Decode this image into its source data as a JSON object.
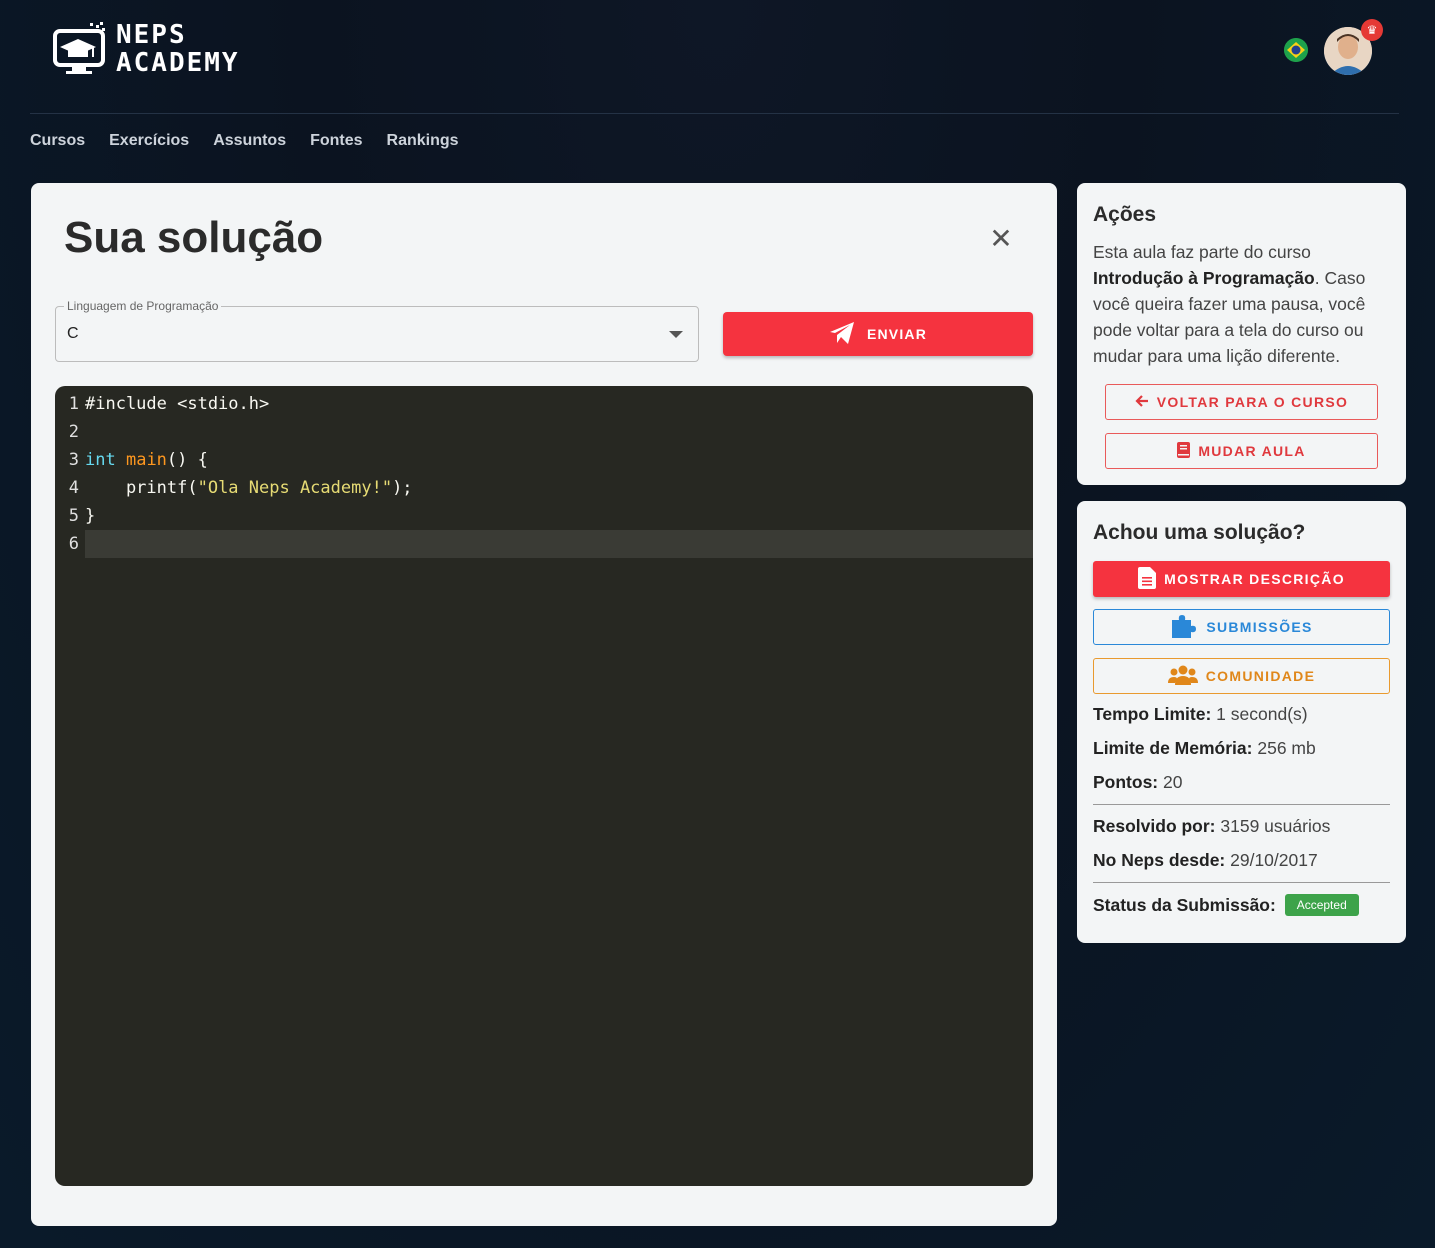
{
  "header": {
    "logo_line1": "NEPS",
    "logo_line2": "ACADEMY",
    "flag_icon": "brazil-flag-icon",
    "avatar_icon": "user-avatar",
    "crown_icon": "crown-icon"
  },
  "nav": {
    "items": [
      "Cursos",
      "Exercícios",
      "Assuntos",
      "Fontes",
      "Rankings"
    ]
  },
  "editor_panel": {
    "title": "Sua solução",
    "language_label": "Linguagem de Programação",
    "language_value": "C",
    "send_label": "ENVIAR",
    "code": {
      "lines": [
        {
          "n": "1",
          "text": "#include <stdio.h>"
        },
        {
          "n": "2",
          "text": ""
        },
        {
          "n": "3",
          "kw": "int",
          "fn": "main",
          "rest": "() {"
        },
        {
          "n": "4",
          "pre": "    printf(",
          "str": "\"Ola Neps Academy!\"",
          "post": ");"
        },
        {
          "n": "5",
          "text": "}"
        },
        {
          "n": "6",
          "text": ""
        }
      ]
    }
  },
  "actions_card": {
    "title": "Ações",
    "text_before": "Esta aula faz parte do curso ",
    "course_name": "Introdução à Programação",
    "text_after": ". Caso você queira fazer uma pausa, você pode voltar para a tela do curso ou mudar para uma lição diferente.",
    "back_label": "VOLTAR PARA O CURSO",
    "change_label": "MUDAR AULA"
  },
  "solution_card": {
    "title": "Achou uma solução?",
    "show_description_label": "MOSTRAR DESCRIÇÃO",
    "submissions_label": "SUBMISSÕES",
    "community_label": "COMUNIDADE",
    "time_limit_label": "Tempo Limite:",
    "time_limit_value": "1 second(s)",
    "memory_label": "Limite de Memória:",
    "memory_value": "256 mb",
    "points_label": "Pontos:",
    "points_value": "20",
    "solved_by_label": "Resolvido por:",
    "solved_by_value": "3159 usuários",
    "since_label": "No Neps desde:",
    "since_value": "29/10/2017",
    "status_label": "Status da Submissão:",
    "status_value": "Accepted",
    "status_color": "#3da34a"
  },
  "colors": {
    "accent_red": "#f5333f",
    "blue": "#2a88d8",
    "orange": "#e0871a",
    "editor_bg": "#272822"
  }
}
